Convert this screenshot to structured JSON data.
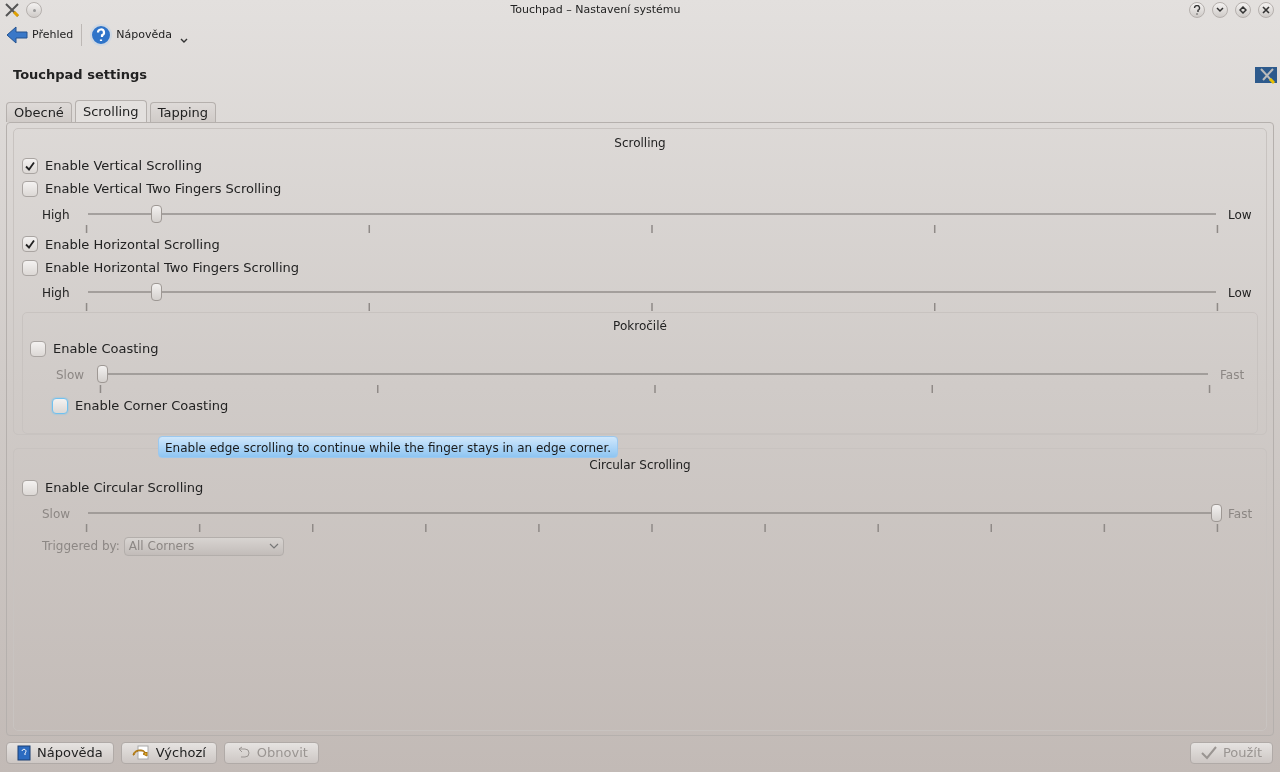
{
  "window": {
    "title": "Touchpad – Nastavení systému"
  },
  "toolbar": [
    {
      "label": "Přehled",
      "kind": "back"
    },
    {
      "label": "Nápověda",
      "kind": "help"
    }
  ],
  "header": {
    "title": "Touchpad settings"
  },
  "tabs": [
    {
      "label": "Obecné",
      "selected": false
    },
    {
      "label": "Scrolling",
      "selected": true
    },
    {
      "label": "Tapping",
      "selected": false
    }
  ],
  "scrolling_group": {
    "title": "Scrolling",
    "rows": [
      {
        "kind": "checkbox",
        "label": "Enable Vertical Scrolling",
        "checked": true
      },
      {
        "kind": "checkbox",
        "label": "Enable Vertical Two Fingers Scrolling",
        "checked": false
      },
      {
        "kind": "slider",
        "min_label": "High",
        "max_label": "Low",
        "level": 0.06,
        "disabled": false
      },
      {
        "kind": "checkbox",
        "label": "Enable Horizontal Scrolling",
        "checked": true
      },
      {
        "kind": "checkbox",
        "label": "Enable Horizontal Two Fingers Scrolling",
        "checked": false
      },
      {
        "kind": "slider",
        "min_label": "High",
        "max_label": "Low",
        "level": 0.06,
        "disabled": false
      }
    ],
    "advanced": {
      "title": "Pokročilé",
      "rows": [
        {
          "kind": "checkbox",
          "label": "Enable Coasting",
          "checked": false
        },
        {
          "kind": "slider",
          "min_label": "Slow",
          "max_label": "Fast",
          "level": 0,
          "disabled": true
        },
        {
          "kind": "checkbox",
          "label": "Enable Corner Coasting",
          "checked": false,
          "focused": true
        }
      ]
    }
  },
  "tooltip": {
    "text": "Enable edge scrolling to continue while the finger stays in an edge corner."
  },
  "circular_group": {
    "title": "Circular Scrolling",
    "rows": [
      {
        "kind": "checkbox",
        "label": "Enable Circular Scrolling",
        "checked": false
      },
      {
        "kind": "slider",
        "min_label": "Slow",
        "max_label": "Fast",
        "level": 1,
        "disabled": true
      },
      {
        "kind": "combo",
        "label": "Triggered by:",
        "value": "All Corners",
        "disabled": true
      }
    ]
  },
  "buttons": [
    {
      "label": "Nápověda",
      "kind": "help",
      "disabled": false
    },
    {
      "label": "Výchozí",
      "kind": "defaults",
      "disabled": false
    },
    {
      "label": "Obnovit",
      "kind": "reset",
      "disabled": true
    },
    {
      "label": "Použít",
      "kind": "apply",
      "disabled": true
    }
  ]
}
